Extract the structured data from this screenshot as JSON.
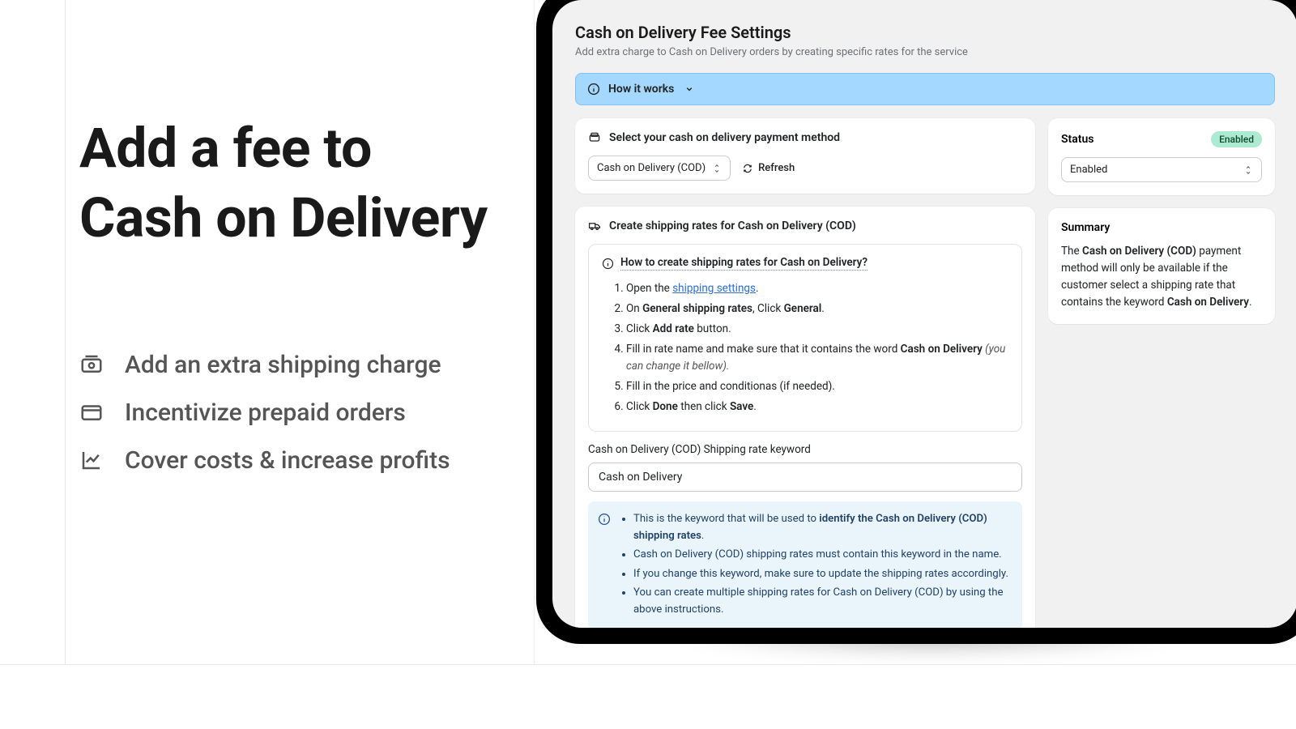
{
  "left": {
    "headline_line1": "Add a fee to",
    "headline_line2": "Cash on Delivery",
    "features": [
      "Add an extra shipping charge",
      "Incentivize prepaid orders",
      "Cover costs & increase profits"
    ]
  },
  "page": {
    "title": "Cash on Delivery Fee Settings",
    "subtitle": "Add extra charge to Cash on Delivery orders by creating specific rates for the service",
    "how_it_works": "How it works"
  },
  "payment_card": {
    "header": "Select your cash on delivery payment method",
    "selected": "Cash on Delivery (COD)",
    "refresh": "Refresh"
  },
  "rates_card": {
    "header": "Create shipping rates for Cash on Delivery (COD)",
    "help_title": "How to create shipping rates for Cash on Delivery?",
    "step1_pre": "Open the ",
    "step1_link": "shipping settings",
    "step1_post": ".",
    "step2_a": "On ",
    "step2_b": "General shipping rates",
    "step2_c": ", Click ",
    "step2_d": "General",
    "step2_e": ".",
    "step3_a": "Click ",
    "step3_b": "Add rate",
    "step3_c": " button.",
    "step4_a": "Fill in rate name and make sure that it contains the word ",
    "step4_b": "Cash on Delivery",
    "step4_c": " (you can change it bellow).",
    "step5": "Fill in the price and conditionas (if needed).",
    "step6_a": "Click ",
    "step6_b": "Done",
    "step6_c": " then click ",
    "step6_d": "Save",
    "step6_e": ".",
    "keyword_label": "Cash on Delivery (COD) Shipping rate keyword",
    "keyword_value": "Cash on Delivery",
    "info1_a": "This is the keyword that will be used to ",
    "info1_b": "identify the Cash on Delivery (COD) shipping rates",
    "info1_c": ".",
    "info2": "Cash on Delivery (COD) shipping rates must contain this keyword in the name.",
    "info3": "If you change this keyword, make sure to update the shipping rates accordingly.",
    "info4": "You can create multiple shipping rates for Cash on Delivery (COD) by using the above instructions."
  },
  "status_card": {
    "label": "Status",
    "badge": "Enabled",
    "select_value": "Enabled"
  },
  "summary_card": {
    "title": "Summary",
    "t1": "The ",
    "t2": "Cash on Delivery (COD)",
    "t3": " payment method will only be available if the customer select a shipping rate that contains the keyword ",
    "t4": "Cash on Delivery",
    "t5": "."
  }
}
